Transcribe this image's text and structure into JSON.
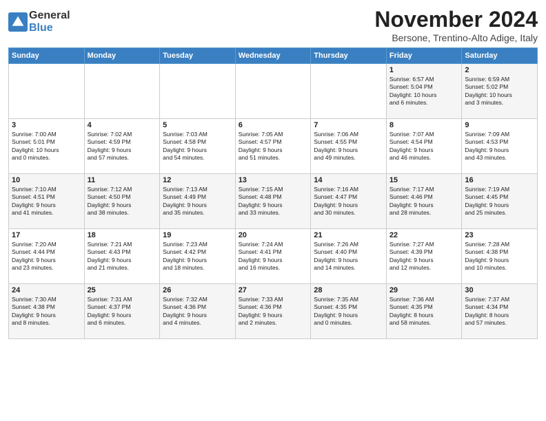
{
  "logo": {
    "general": "General",
    "blue": "Blue"
  },
  "title": "November 2024",
  "subtitle": "Bersone, Trentino-Alto Adige, Italy",
  "headers": [
    "Sunday",
    "Monday",
    "Tuesday",
    "Wednesday",
    "Thursday",
    "Friday",
    "Saturday"
  ],
  "weeks": [
    [
      {
        "day": "",
        "info": ""
      },
      {
        "day": "",
        "info": ""
      },
      {
        "day": "",
        "info": ""
      },
      {
        "day": "",
        "info": ""
      },
      {
        "day": "",
        "info": ""
      },
      {
        "day": "1",
        "info": "Sunrise: 6:57 AM\nSunset: 5:04 PM\nDaylight: 10 hours\nand 6 minutes."
      },
      {
        "day": "2",
        "info": "Sunrise: 6:59 AM\nSunset: 5:02 PM\nDaylight: 10 hours\nand 3 minutes."
      }
    ],
    [
      {
        "day": "3",
        "info": "Sunrise: 7:00 AM\nSunset: 5:01 PM\nDaylight: 10 hours\nand 0 minutes."
      },
      {
        "day": "4",
        "info": "Sunrise: 7:02 AM\nSunset: 4:59 PM\nDaylight: 9 hours\nand 57 minutes."
      },
      {
        "day": "5",
        "info": "Sunrise: 7:03 AM\nSunset: 4:58 PM\nDaylight: 9 hours\nand 54 minutes."
      },
      {
        "day": "6",
        "info": "Sunrise: 7:05 AM\nSunset: 4:57 PM\nDaylight: 9 hours\nand 51 minutes."
      },
      {
        "day": "7",
        "info": "Sunrise: 7:06 AM\nSunset: 4:55 PM\nDaylight: 9 hours\nand 49 minutes."
      },
      {
        "day": "8",
        "info": "Sunrise: 7:07 AM\nSunset: 4:54 PM\nDaylight: 9 hours\nand 46 minutes."
      },
      {
        "day": "9",
        "info": "Sunrise: 7:09 AM\nSunset: 4:53 PM\nDaylight: 9 hours\nand 43 minutes."
      }
    ],
    [
      {
        "day": "10",
        "info": "Sunrise: 7:10 AM\nSunset: 4:51 PM\nDaylight: 9 hours\nand 41 minutes."
      },
      {
        "day": "11",
        "info": "Sunrise: 7:12 AM\nSunset: 4:50 PM\nDaylight: 9 hours\nand 38 minutes."
      },
      {
        "day": "12",
        "info": "Sunrise: 7:13 AM\nSunset: 4:49 PM\nDaylight: 9 hours\nand 35 minutes."
      },
      {
        "day": "13",
        "info": "Sunrise: 7:15 AM\nSunset: 4:48 PM\nDaylight: 9 hours\nand 33 minutes."
      },
      {
        "day": "14",
        "info": "Sunrise: 7:16 AM\nSunset: 4:47 PM\nDaylight: 9 hours\nand 30 minutes."
      },
      {
        "day": "15",
        "info": "Sunrise: 7:17 AM\nSunset: 4:46 PM\nDaylight: 9 hours\nand 28 minutes."
      },
      {
        "day": "16",
        "info": "Sunrise: 7:19 AM\nSunset: 4:45 PM\nDaylight: 9 hours\nand 25 minutes."
      }
    ],
    [
      {
        "day": "17",
        "info": "Sunrise: 7:20 AM\nSunset: 4:44 PM\nDaylight: 9 hours\nand 23 minutes."
      },
      {
        "day": "18",
        "info": "Sunrise: 7:21 AM\nSunset: 4:43 PM\nDaylight: 9 hours\nand 21 minutes."
      },
      {
        "day": "19",
        "info": "Sunrise: 7:23 AM\nSunset: 4:42 PM\nDaylight: 9 hours\nand 18 minutes."
      },
      {
        "day": "20",
        "info": "Sunrise: 7:24 AM\nSunset: 4:41 PM\nDaylight: 9 hours\nand 16 minutes."
      },
      {
        "day": "21",
        "info": "Sunrise: 7:26 AM\nSunset: 4:40 PM\nDaylight: 9 hours\nand 14 minutes."
      },
      {
        "day": "22",
        "info": "Sunrise: 7:27 AM\nSunset: 4:39 PM\nDaylight: 9 hours\nand 12 minutes."
      },
      {
        "day": "23",
        "info": "Sunrise: 7:28 AM\nSunset: 4:38 PM\nDaylight: 9 hours\nand 10 minutes."
      }
    ],
    [
      {
        "day": "24",
        "info": "Sunrise: 7:30 AM\nSunset: 4:38 PM\nDaylight: 9 hours\nand 8 minutes."
      },
      {
        "day": "25",
        "info": "Sunrise: 7:31 AM\nSunset: 4:37 PM\nDaylight: 9 hours\nand 6 minutes."
      },
      {
        "day": "26",
        "info": "Sunrise: 7:32 AM\nSunset: 4:36 PM\nDaylight: 9 hours\nand 4 minutes."
      },
      {
        "day": "27",
        "info": "Sunrise: 7:33 AM\nSunset: 4:36 PM\nDaylight: 9 hours\nand 2 minutes."
      },
      {
        "day": "28",
        "info": "Sunrise: 7:35 AM\nSunset: 4:35 PM\nDaylight: 9 hours\nand 0 minutes."
      },
      {
        "day": "29",
        "info": "Sunrise: 7:36 AM\nSunset: 4:35 PM\nDaylight: 8 hours\nand 58 minutes."
      },
      {
        "day": "30",
        "info": "Sunrise: 7:37 AM\nSunset: 4:34 PM\nDaylight: 8 hours\nand 57 minutes."
      }
    ]
  ]
}
